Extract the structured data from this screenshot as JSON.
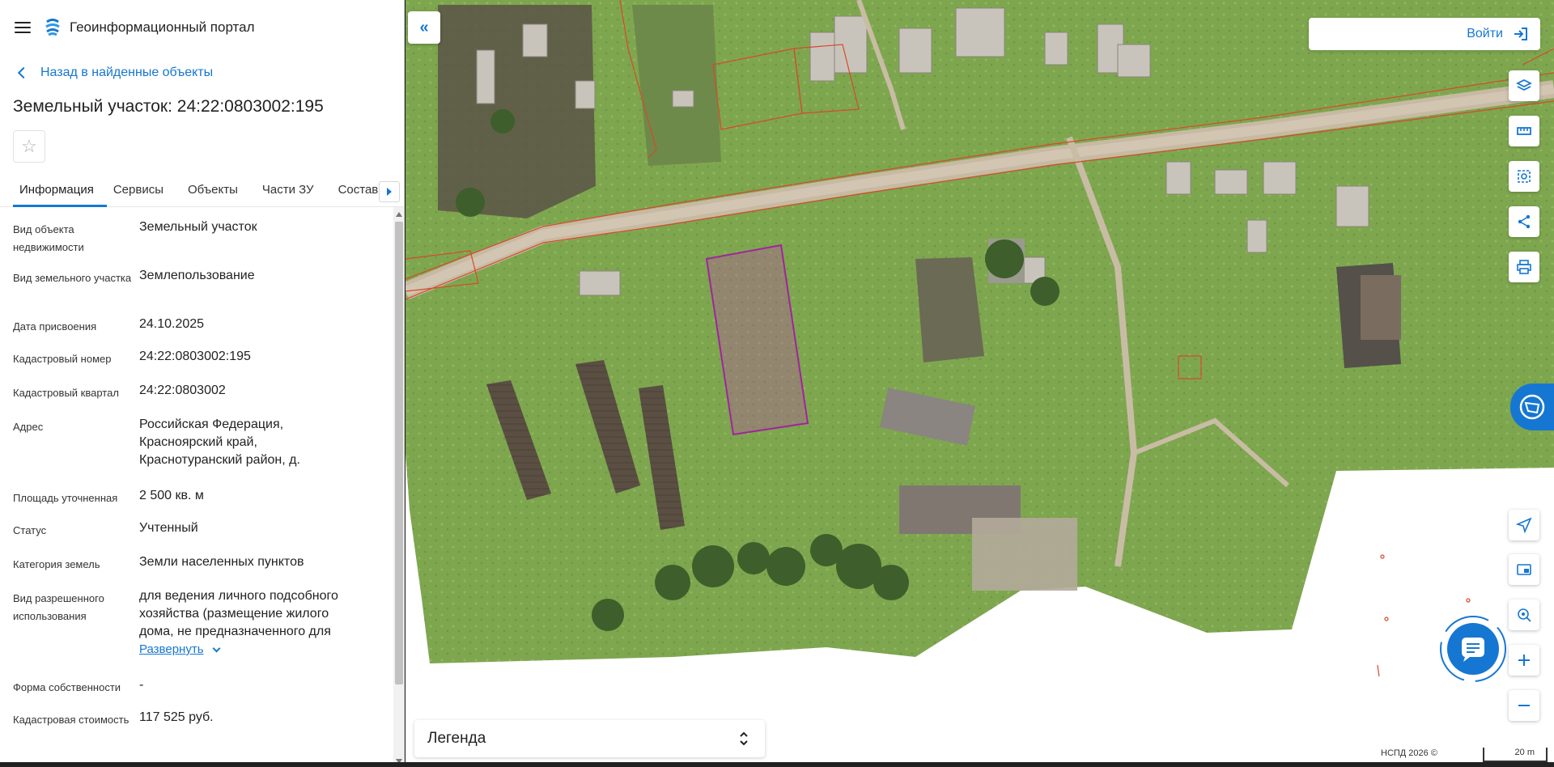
{
  "app": {
    "title": "Геоинформационный портал"
  },
  "nav": {
    "back_label": "Назад в найденные объекты"
  },
  "object": {
    "title": "Земельный участок: 24:22:0803002:195"
  },
  "tabs": [
    {
      "label": "Информация"
    },
    {
      "label": "Сервисы"
    },
    {
      "label": "Объекты"
    },
    {
      "label": "Части ЗУ"
    },
    {
      "label": "Состав"
    }
  ],
  "properties": [
    {
      "label": "Вид объекта недвижимости",
      "value": "Земельный участок"
    },
    {
      "label": "Вид земельного участка",
      "value": "Землепользование"
    },
    {
      "label": "Дата присвоения",
      "value": "24.10.2025"
    },
    {
      "label": "Кадастровый номер",
      "value": "24:22:0803002:195"
    },
    {
      "label": "Кадастровый квартал",
      "value": "24:22:0803002"
    },
    {
      "label": "Адрес",
      "value": "Российская Федерация, Красноярский край, Краснотуранский район, д."
    },
    {
      "label": "Площадь уточненная",
      "value": "2 500 кв. м"
    },
    {
      "label": "Статус",
      "value": "Учтенный"
    },
    {
      "label": "Категория земель",
      "value": "Земли населенных пунктов"
    },
    {
      "label": "Вид разрешенного использования",
      "value": "для ведения личного подсобного хозяйства (размещение жилого дома, не предназначенного для",
      "expand": "Развернуть"
    },
    {
      "label": "Форма собственности",
      "value": "-"
    },
    {
      "label": "Кадастровая стоимость",
      "value": "117 525 руб."
    }
  ],
  "map": {
    "login_label": "Войти",
    "legend_label": "Легенда",
    "attribution": "НСПД 2026 ©",
    "scale_label": "20 m",
    "tools": [
      "layers-icon",
      "ruler-icon",
      "select-area-icon",
      "share-icon",
      "print-icon"
    ],
    "nav_tools": [
      "geolocation-icon",
      "minimap-icon",
      "search-location-icon",
      "zoom-in-icon",
      "zoom-out-icon"
    ]
  },
  "colors": {
    "accent": "#1677d2",
    "parcel_outline": "#a0249e",
    "cadastral_lines": "#d64a2a"
  }
}
